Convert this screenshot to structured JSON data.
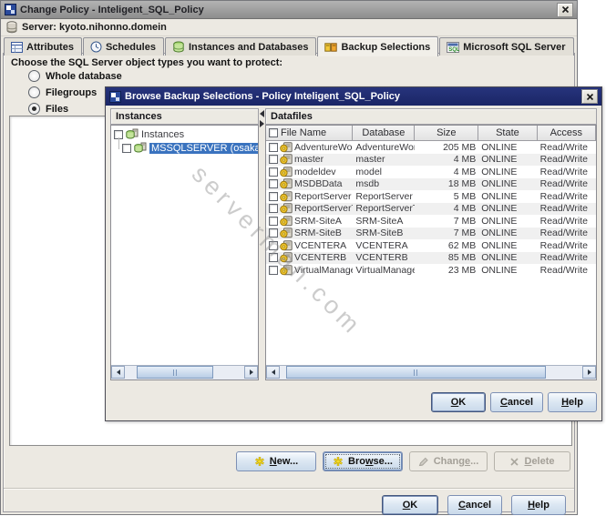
{
  "watermark": "serverman.com",
  "colors": {
    "accent_navy": "#1e2a6e",
    "selection_blue": "#3a73bf",
    "button_face": "#dde8f3",
    "star_yellow": "#e6c619"
  },
  "main_dialog": {
    "title": "Change Policy - Inteligent_SQL_Policy",
    "window_icon": "policy-window-icon",
    "close_icon": "close-icon",
    "server_line": {
      "icon": "server-database-icon",
      "label": "Server: kyoto.nihonno.domein"
    },
    "tabs": [
      {
        "label": "Attributes",
        "icon": "attributes-icon",
        "active": false
      },
      {
        "label": "Schedules",
        "icon": "schedules-clock-icon",
        "active": false
      },
      {
        "label": "Instances and Databases",
        "icon": "instances-db-icon",
        "active": false
      },
      {
        "label": "Backup Selections",
        "icon": "backup-selections-icon",
        "active": true
      },
      {
        "label": "Microsoft SQL Server",
        "icon": "sql-server-icon",
        "active": false
      }
    ],
    "prompt": "Choose the SQL Server object types you want to protect:",
    "radio_group": [
      {
        "label": "Whole database",
        "selected": false
      },
      {
        "label": "Filegroups",
        "selected": false
      },
      {
        "label": "Files",
        "selected": true
      }
    ],
    "action_buttons": [
      {
        "label": "New...",
        "mnemonic": "N",
        "icon": "star-icon",
        "enabled": true,
        "focused": false
      },
      {
        "label": "Browse...",
        "mnemonic": "w",
        "icon": "star-icon",
        "enabled": true,
        "focused": true
      },
      {
        "label": "Change...",
        "mnemonic": "e",
        "icon": "change-pencil-icon",
        "enabled": false,
        "focused": false
      },
      {
        "label": "Delete",
        "mnemonic": "D",
        "icon": "delete-x-icon",
        "enabled": false,
        "focused": false
      }
    ],
    "footer_buttons": [
      {
        "label": "OK",
        "mnemonic": "O",
        "default": true
      },
      {
        "label": "Cancel",
        "mnemonic": "C",
        "default": false
      },
      {
        "label": "Help",
        "mnemonic": "H",
        "default": false
      }
    ]
  },
  "browse_dialog": {
    "title": "Browse Backup Selections - Policy Inteligent_SQL_Policy",
    "window_icon": "policy-window-icon",
    "close_icon": "close-icon",
    "instances_panel": {
      "header": "Instances",
      "tree": [
        {
          "label": "Instances",
          "icon": "instance-server-icon",
          "level": 0,
          "selected": false,
          "checked": false
        },
        {
          "label": "MSSQLSERVER (osaka.n",
          "icon": "instance-server-icon",
          "level": 1,
          "selected": true,
          "checked": false
        }
      ]
    },
    "datafiles_panel": {
      "header": "Datafiles",
      "columns": [
        "File Name",
        "Database",
        "Size",
        "State",
        "Access"
      ],
      "row_icon": "datafile-icon",
      "rows": [
        {
          "file_name": "AdventureWorks...",
          "database": "AdventureWork...",
          "size": "205 MB",
          "state": "ONLINE",
          "access": "Read/Write"
        },
        {
          "file_name": "master",
          "database": "master",
          "size": "4 MB",
          "state": "ONLINE",
          "access": "Read/Write"
        },
        {
          "file_name": "modeldev",
          "database": "model",
          "size": "4 MB",
          "state": "ONLINE",
          "access": "Read/Write"
        },
        {
          "file_name": "MSDBData",
          "database": "msdb",
          "size": "18 MB",
          "state": "ONLINE",
          "access": "Read/Write"
        },
        {
          "file_name": "ReportServer",
          "database": "ReportServer",
          "size": "5 MB",
          "state": "ONLINE",
          "access": "Read/Write"
        },
        {
          "file_name": "ReportServerTe...",
          "database": "ReportServerT...",
          "size": "4 MB",
          "state": "ONLINE",
          "access": "Read/Write"
        },
        {
          "file_name": "SRM-SiteA",
          "database": "SRM-SiteA",
          "size": "7 MB",
          "state": "ONLINE",
          "access": "Read/Write"
        },
        {
          "file_name": "SRM-SiteB",
          "database": "SRM-SiteB",
          "size": "7 MB",
          "state": "ONLINE",
          "access": "Read/Write"
        },
        {
          "file_name": "VCENTERA",
          "database": "VCENTERA",
          "size": "62 MB",
          "state": "ONLINE",
          "access": "Read/Write"
        },
        {
          "file_name": "VCENTERB",
          "database": "VCENTERB",
          "size": "85 MB",
          "state": "ONLINE",
          "access": "Read/Write"
        },
        {
          "file_name": "VirtualManager...",
          "database": "VirtualManager...",
          "size": "23 MB",
          "state": "ONLINE",
          "access": "Read/Write"
        }
      ]
    },
    "footer_buttons": [
      {
        "label": "OK",
        "mnemonic": "O",
        "default": true
      },
      {
        "label": "Cancel",
        "mnemonic": "C",
        "default": false
      },
      {
        "label": "Help",
        "mnemonic": "H",
        "default": false
      }
    ]
  }
}
